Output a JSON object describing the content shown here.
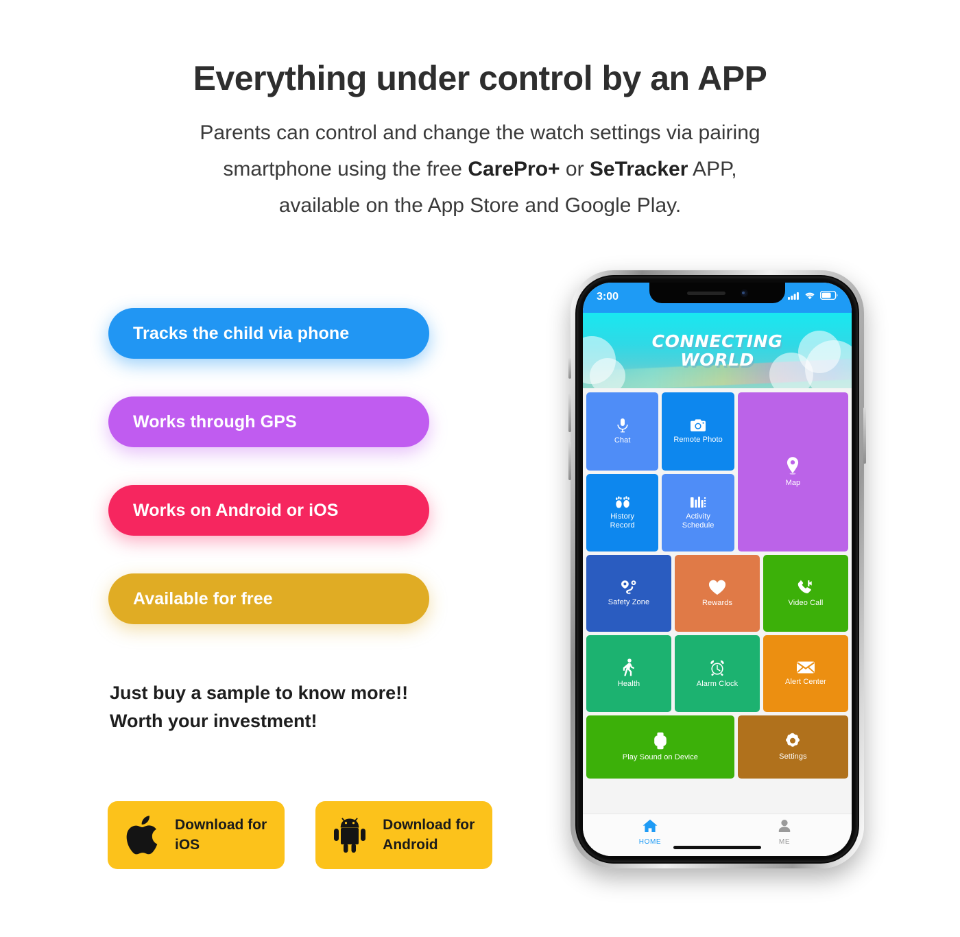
{
  "header": {
    "headline": "Everything under control by an APP",
    "subhead_line1": "Parents can control and change the watch settings via pairing",
    "subhead_line2_a": "smartphone using the free ",
    "subhead_brand1": "CarePro+",
    "subhead_line2_b": " or ",
    "subhead_brand2": "SeTracker",
    "subhead_line2_c": " APP,",
    "subhead_line3": "available on the App Store and Google Play."
  },
  "features": [
    {
      "label": "Tracks the child via phone",
      "color": "#2196f3"
    },
    {
      "label": "Works through GPS",
      "color": "#c05cf0"
    },
    {
      "label": "Works on Android or iOS",
      "color": "#f6265f"
    },
    {
      "label": "Available for free",
      "color": "#e0ac24"
    }
  ],
  "tagline": {
    "line1": "Just buy a sample to know more!!",
    "line2": "Worth your investment!"
  },
  "store_buttons": [
    {
      "icon": "apple-icon",
      "label": "Download for\niOS",
      "bg": "#fcc21b"
    },
    {
      "icon": "android-icon",
      "label": "Download for\nAndroid",
      "bg": "#fcc21b"
    }
  ],
  "phone": {
    "status_bar": {
      "time": "3:00",
      "signal_icon": "cellular-signal-icon",
      "wifi_icon": "wifi-icon",
      "battery_icon": "battery-icon",
      "bg": "#1e9bf5"
    },
    "banner": {
      "line1": "CONNECTING",
      "line2": "WORLD"
    },
    "tiles": [
      {
        "id": "chat",
        "label": "Chat",
        "icon": "microphone-icon",
        "color": "#4f8df7"
      },
      {
        "id": "remote-photo",
        "label": "Remote Photo",
        "icon": "camera-icon",
        "color": "#0d87ee"
      },
      {
        "id": "history",
        "label": "History\nRecord",
        "icon": "footprints-icon",
        "color": "#0d87ee"
      },
      {
        "id": "activity",
        "label": "Activity\nSchedule",
        "icon": "chart-bars-icon",
        "color": "#4f8df7"
      },
      {
        "id": "map",
        "label": "Map",
        "icon": "map-pin-icon",
        "color": "#bb63e8"
      },
      {
        "id": "safety-zone",
        "label": "Safety Zone",
        "icon": "geofence-icon",
        "color": "#2a5cc0"
      },
      {
        "id": "rewards",
        "label": "Rewards",
        "icon": "heart-icon",
        "color": "#e07a47"
      },
      {
        "id": "video-call",
        "label": "Video Call",
        "icon": "video-call-icon",
        "color": "#3cb009"
      },
      {
        "id": "health",
        "label": "Health",
        "icon": "walking-icon",
        "color": "#1cb270"
      },
      {
        "id": "alarm-clock",
        "label": "Alarm Clock",
        "icon": "alarm-clock-icon",
        "color": "#1cb270"
      },
      {
        "id": "alert-center",
        "label": "Alert Center",
        "icon": "envelope-icon",
        "color": "#ec8f11"
      },
      {
        "id": "play-sound",
        "label": "Play Sound on Device",
        "icon": "watch-icon",
        "color": "#3cb009"
      },
      {
        "id": "settings",
        "label": "Settings",
        "icon": "gear-icon",
        "color": "#b0711c"
      }
    ],
    "tabbar": [
      {
        "id": "home",
        "label": "HOME",
        "icon": "home-icon",
        "active": true
      },
      {
        "id": "me",
        "label": "ME",
        "icon": "person-icon",
        "active": false
      }
    ]
  }
}
